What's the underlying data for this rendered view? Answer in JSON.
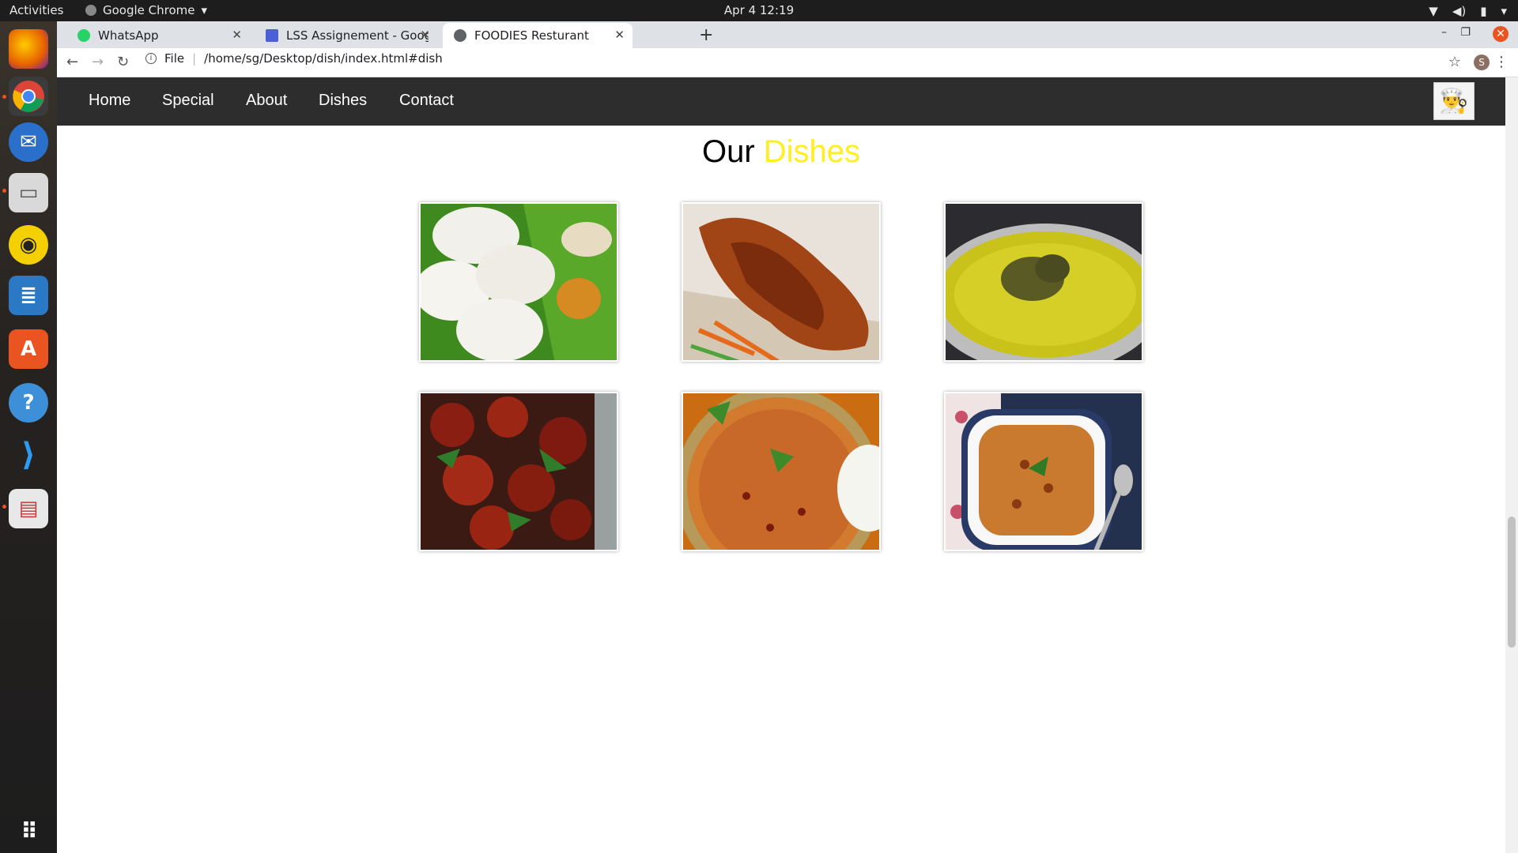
{
  "topbar": {
    "activities": "Activities",
    "app_name": "Google Chrome",
    "clock": "Apr 4  12:19"
  },
  "dock": {
    "icons": [
      "firefox-icon",
      "chrome-icon",
      "thunderbird-icon",
      "files-icon",
      "rhythmbox-icon",
      "writer-icon",
      "software-center-icon",
      "help-icon",
      "vscode-icon",
      "document-viewer-icon",
      "show-apps-icon"
    ]
  },
  "tabs": [
    {
      "title": "WhatsApp",
      "color": "#25d366"
    },
    {
      "title": "LSS Assignement - Googl",
      "color": "#4b5fd6"
    },
    {
      "title": "FOODIES Resturant",
      "color": "#5f6368"
    }
  ],
  "address": {
    "scheme": "File",
    "url": "/home/sg/Desktop/dish/index.html#dish"
  },
  "profile_initial": "S",
  "nav": [
    "Home",
    "Special",
    "About",
    "Dishes",
    "Contact"
  ],
  "section": {
    "title_prefix": "Our",
    "title_highlight": "Dishes"
  },
  "colors": {
    "navbar": "#2d2d2d",
    "highlight": "#ffee22"
  },
  "dishes": [
    {
      "name": "idli-dish-image"
    },
    {
      "name": "tandoori-chicken-dish-image"
    },
    {
      "name": "biryani-dish-image"
    },
    {
      "name": "chilli-chicken-dish-image"
    },
    {
      "name": "tomato-rice-dish-image"
    },
    {
      "name": "curry-bowl-dish-image"
    }
  ]
}
